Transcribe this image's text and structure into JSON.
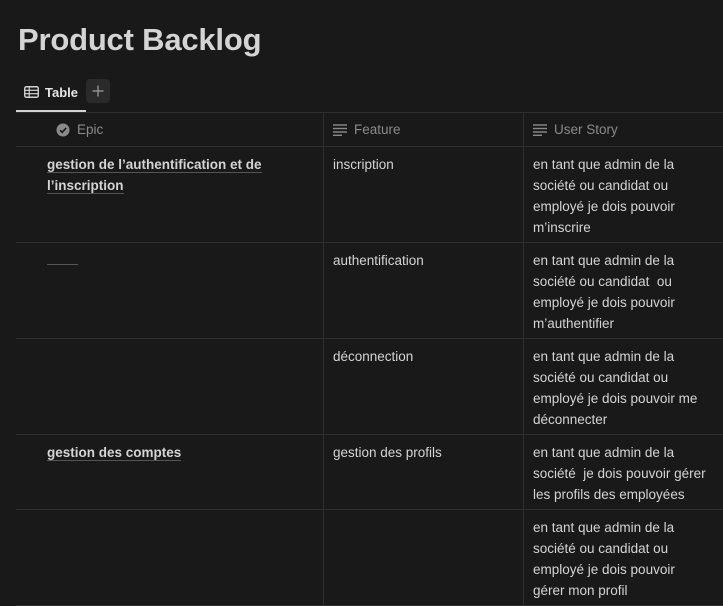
{
  "page": {
    "title": "Product Backlog"
  },
  "tabs": {
    "table_label": "Table"
  },
  "columns": {
    "epic": "Epic",
    "feature": "Feature",
    "user_story": "User Story"
  },
  "rows": [
    {
      "epic_line1": "gestion de l’authentification et de",
      "epic_line2": "l’inscription",
      "feature": "inscription",
      "story": [
        "en tant que admin de la",
        "société ou candidat ou",
        "employé je dois pouvoir",
        "m’inscrire"
      ]
    },
    {
      "epic_line1": "",
      "feature": "authentification",
      "story": [
        "en tant que admin de la",
        "société ou candidat  ou",
        "employé je dois pouvoir",
        "m’authentifier"
      ]
    },
    {
      "epic_line1": "",
      "feature": "déconnection",
      "story": [
        "en tant que admin de la",
        "société ou candidat ou",
        "employé je dois pouvoir me",
        "déconnecter"
      ]
    },
    {
      "epic_line1": "gestion des comptes",
      "feature": "gestion des profils",
      "story": [
        "en tant que admin de la",
        "société  je dois pouvoir gérer",
        "les profils des employées"
      ]
    },
    {
      "epic_line1": "",
      "feature": "",
      "story": [
        "en tant que admin de la",
        "société ou candidat ou",
        "employé je dois pouvoir",
        "gérer mon profil"
      ]
    }
  ]
}
